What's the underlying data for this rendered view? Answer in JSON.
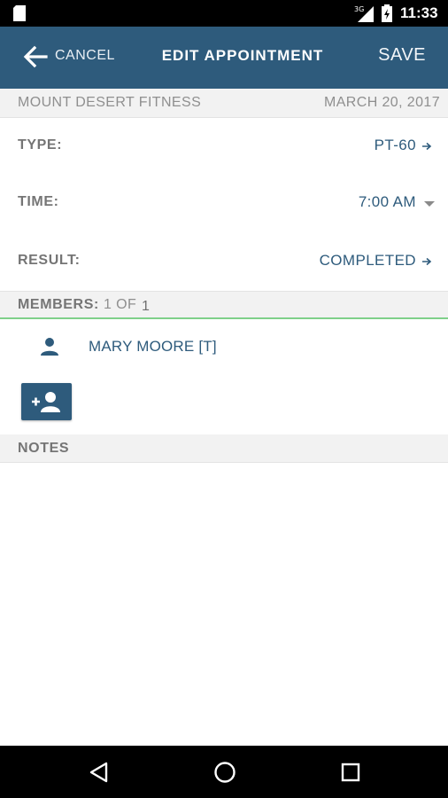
{
  "status_bar": {
    "time": "11:33",
    "network": "3G",
    "icons": [
      "sd-card-icon",
      "signal-icon",
      "battery-icon"
    ]
  },
  "app_bar": {
    "back_icon": "arrow-back-icon",
    "cancel_label": "CANCEL",
    "title": "EDIT APPOINTMENT",
    "save_label": "SAVE",
    "color": "#2e5b7c"
  },
  "info": {
    "location": "MOUNT DESERT FITNESS",
    "date": "MARCH 20, 2017"
  },
  "fields": {
    "type": {
      "label": "TYPE:",
      "value": "PT-60"
    },
    "time": {
      "label": "TIME:",
      "value": "7:00 AM"
    },
    "result": {
      "label": "RESULT:",
      "value": "COMPLETED"
    }
  },
  "members": {
    "label": "MEMBERS:",
    "count_text": "1 OF",
    "count_total": "1",
    "items": [
      {
        "name": "MARY MOORE [T]",
        "icon": "person-icon"
      }
    ],
    "add_icon": "add-person-icon"
  },
  "notes": {
    "label": "NOTES"
  },
  "nav_bar": {
    "icons": [
      "back-triangle-icon",
      "home-circle-icon",
      "recents-square-icon"
    ]
  },
  "colors": {
    "accent": "#2e5b7c",
    "tab_underline": "#7fd08a",
    "section_bg": "#f2f2f2"
  }
}
